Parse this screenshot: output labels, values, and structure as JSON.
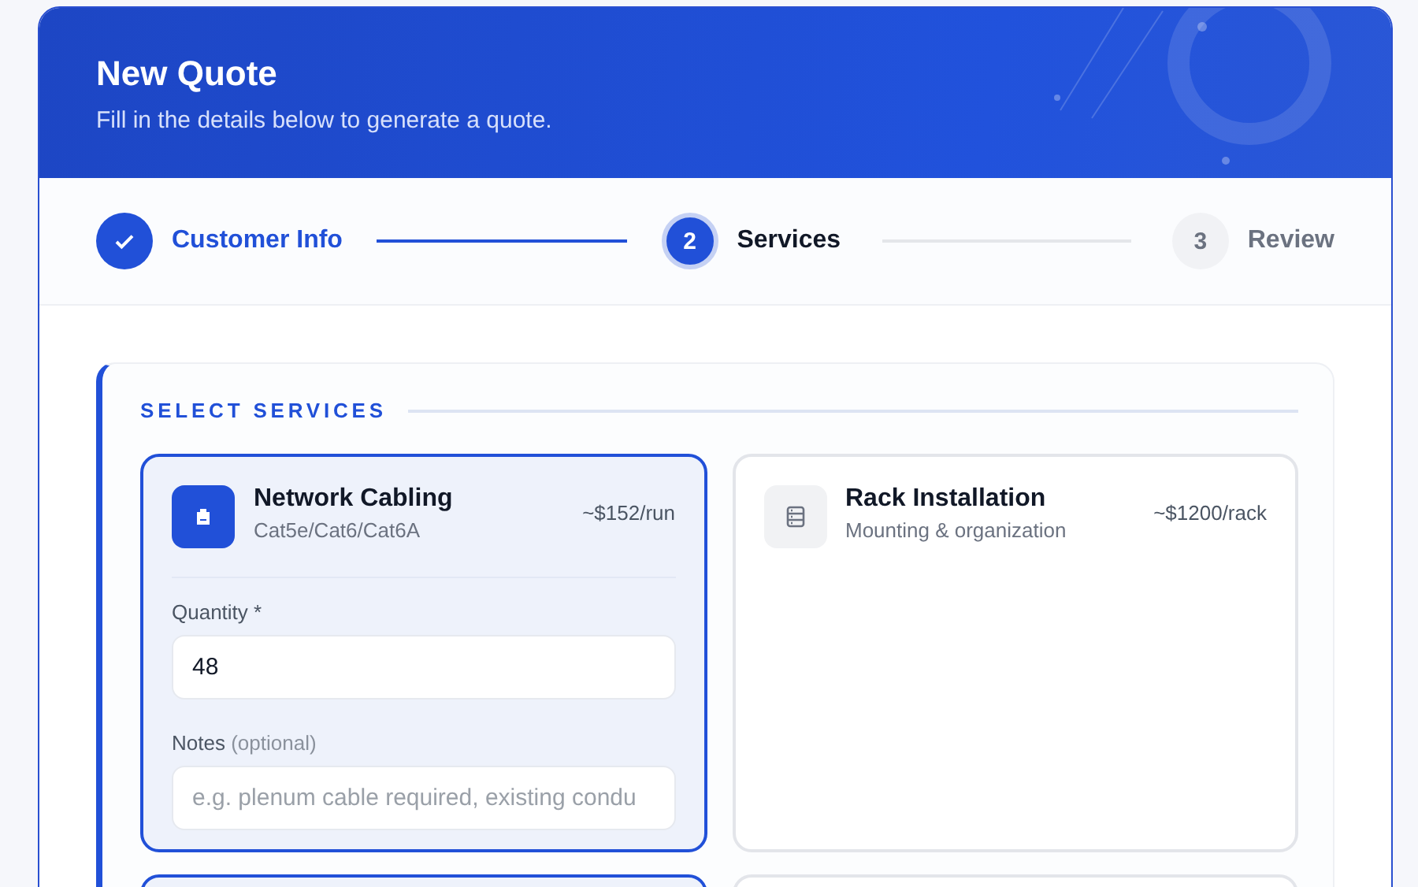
{
  "header": {
    "title": "New Quote",
    "subtitle": "Fill in the details below to generate a quote."
  },
  "steps": [
    {
      "label": "Customer Info",
      "completed": true,
      "selected": false
    },
    {
      "number": "2",
      "label": "Services",
      "completed": false,
      "selected": true
    },
    {
      "number": "3",
      "label": "Review",
      "completed": false,
      "selected": false
    }
  ],
  "section": {
    "title": "SELECT SERVICES",
    "services": [
      {
        "name": "Network Cabling",
        "description": "Cat5e/Cat6/Cat6A",
        "price": "~$152/run",
        "kind": "cable",
        "selected": true,
        "fields": [
          {
            "label": "Quantity *",
            "value": "48"
          },
          {
            "label": "Notes",
            "hint": "(optional)",
            "placeholder": "e.g. plenum cable required, existing condu"
          }
        ]
      },
      {
        "name": "Rack Installation",
        "description": "Mounting & organization",
        "price": "~$1200/rack",
        "kind": "rack",
        "selected": false
      },
      {
        "selected": true
      },
      {
        "selected": false
      }
    ]
  }
}
